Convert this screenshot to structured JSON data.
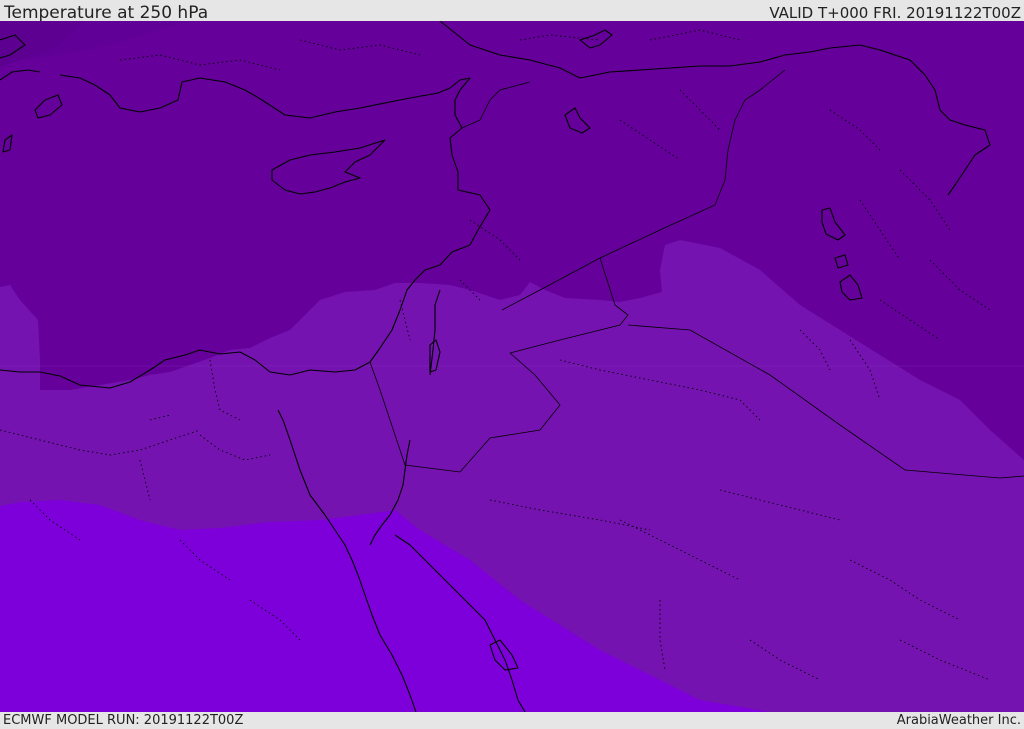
{
  "header": {
    "title": "Temperature at 250 hPa",
    "valid_time": "VALID T+000 FRI. 20191122T00Z"
  },
  "footer": {
    "model_run": "ECMWF MODEL RUN: 20191122T00Z",
    "credit": "ArabiaWeather Inc."
  },
  "map": {
    "field": "temperature",
    "level": "250 hPa",
    "bands": [
      {
        "name": "coldest-band",
        "color": "#5b0090"
      },
      {
        "name": "cold-band",
        "color": "#65009a"
      },
      {
        "name": "mid-band",
        "color": "#7513b0"
      },
      {
        "name": "warm-band",
        "color": "#7d00da"
      }
    ],
    "coastline_color": "#000000",
    "border_style": "dotted"
  }
}
